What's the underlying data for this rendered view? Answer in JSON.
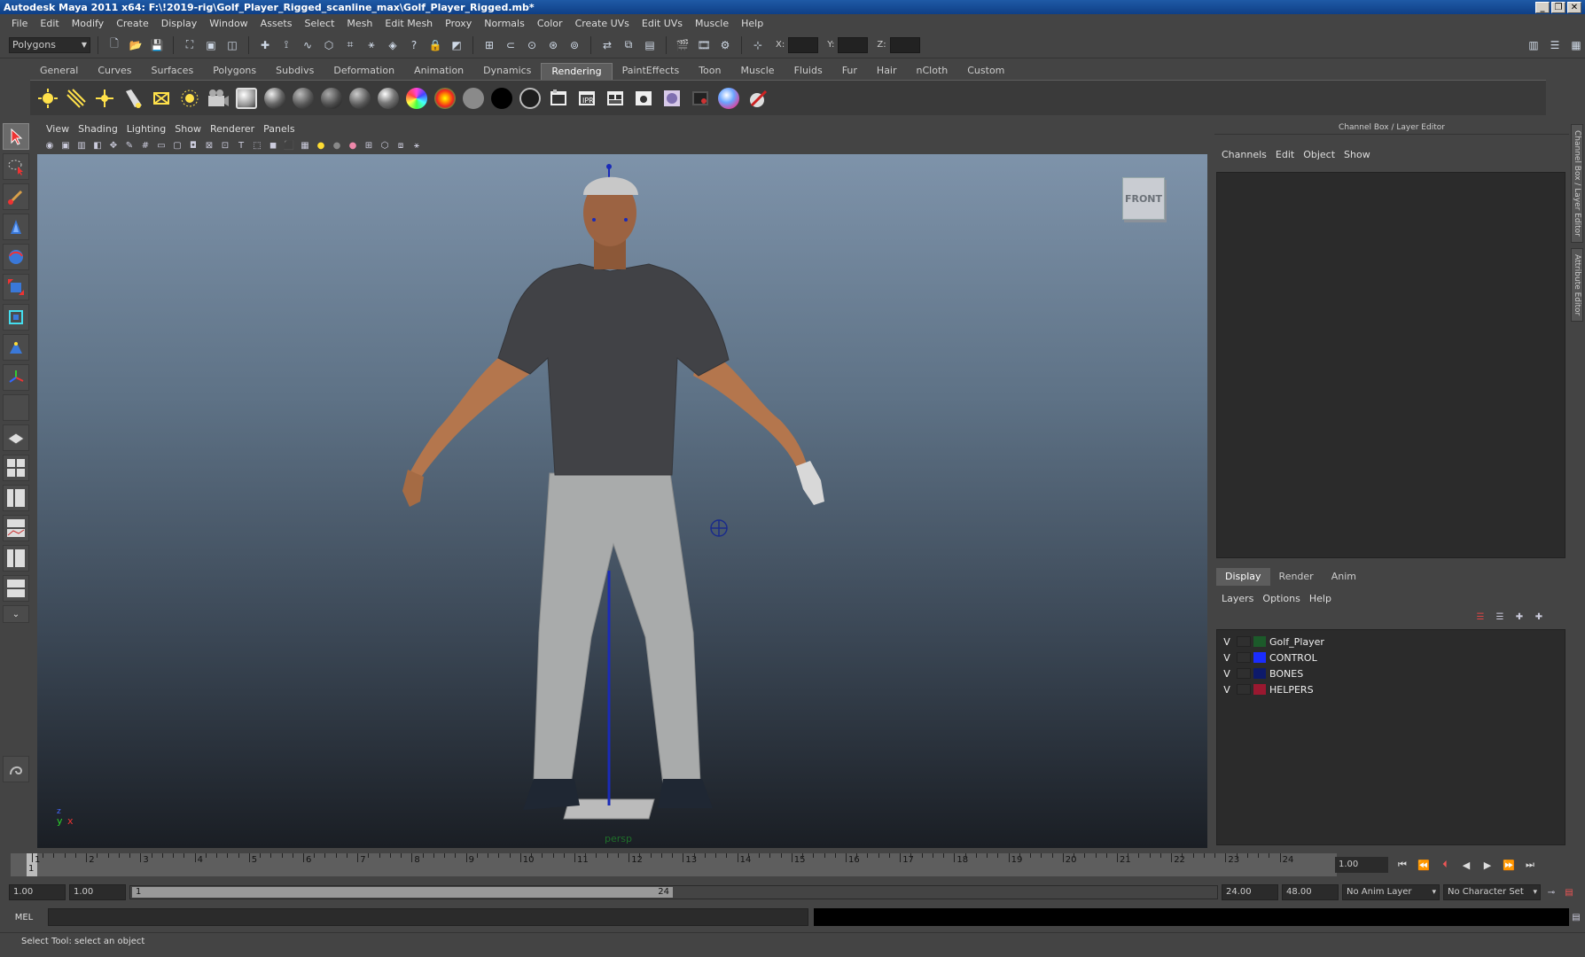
{
  "window": {
    "title": "Autodesk Maya 2011 x64: F:\\!2019-rig\\Golf_Player_Rigged_scanline_max\\Golf_Player_Rigged.mb*",
    "buttons": [
      "_",
      "❐",
      "✕"
    ]
  },
  "menubar": [
    "File",
    "Edit",
    "Modify",
    "Create",
    "Display",
    "Window",
    "Assets",
    "Select",
    "Mesh",
    "Edit Mesh",
    "Proxy",
    "Normals",
    "Color",
    "Create UVs",
    "Edit UVs",
    "Muscle",
    "Help"
  ],
  "statusline": {
    "mode": "Polygons",
    "x_label": "X:",
    "y_label": "Y:",
    "z_label": "Z:"
  },
  "shelf": {
    "tabs": [
      "General",
      "Curves",
      "Surfaces",
      "Polygons",
      "Subdivs",
      "Deformation",
      "Animation",
      "Dynamics",
      "Rendering",
      "PaintEffects",
      "Toon",
      "Muscle",
      "Fluids",
      "Fur",
      "Hair",
      "nCloth",
      "Custom"
    ],
    "active_tab": "Rendering"
  },
  "viewport": {
    "menus": [
      "View",
      "Shading",
      "Lighting",
      "Show",
      "Renderer",
      "Panels"
    ],
    "view_cube_label": "FRONT",
    "camera_label": "persp",
    "axis": {
      "y": "y",
      "x": "x",
      "z": "z"
    }
  },
  "channel_box": {
    "title": "Channel Box / Layer Editor",
    "menus": [
      "Channels",
      "Edit",
      "Object",
      "Show"
    ]
  },
  "layer_editor": {
    "tabs": [
      "Display",
      "Render",
      "Anim"
    ],
    "active_tab": "Display",
    "menus": [
      "Layers",
      "Options",
      "Help"
    ],
    "layers": [
      {
        "visible": "V",
        "name": "Golf_Player",
        "color": "#1c5a2a"
      },
      {
        "visible": "V",
        "name": "CONTROL",
        "color": "#1a2cff"
      },
      {
        "visible": "V",
        "name": "BONES",
        "color": "#0d1a6a"
      },
      {
        "visible": "V",
        "name": "HELPERS",
        "color": "#9a1830"
      }
    ]
  },
  "side_tabs": [
    "Channel Box / Layer Editor",
    "Attribute Editor"
  ],
  "timeline": {
    "ticks": [
      "1",
      "2",
      "3",
      "4",
      "5",
      "6",
      "7",
      "8",
      "9",
      "10",
      "11",
      "12",
      "13",
      "14",
      "15",
      "16",
      "17",
      "18",
      "19",
      "20",
      "21",
      "22",
      "23",
      "24"
    ],
    "current_frame": "1",
    "current_field": "1.00"
  },
  "range": {
    "start": "1.00",
    "playback_start": "1.00",
    "thumb_start": "1",
    "thumb_end": "24",
    "playback_end": "24.00",
    "end": "48.00",
    "anim_layer": "No Anim Layer",
    "character_set": "No Character Set"
  },
  "command_line": {
    "label": "MEL"
  },
  "help_line": "Select Tool: select an object",
  "colors": {
    "ui_bg": "#444444",
    "field_bg": "#2b2b2b",
    "title_bar": "#1f5aa6"
  }
}
